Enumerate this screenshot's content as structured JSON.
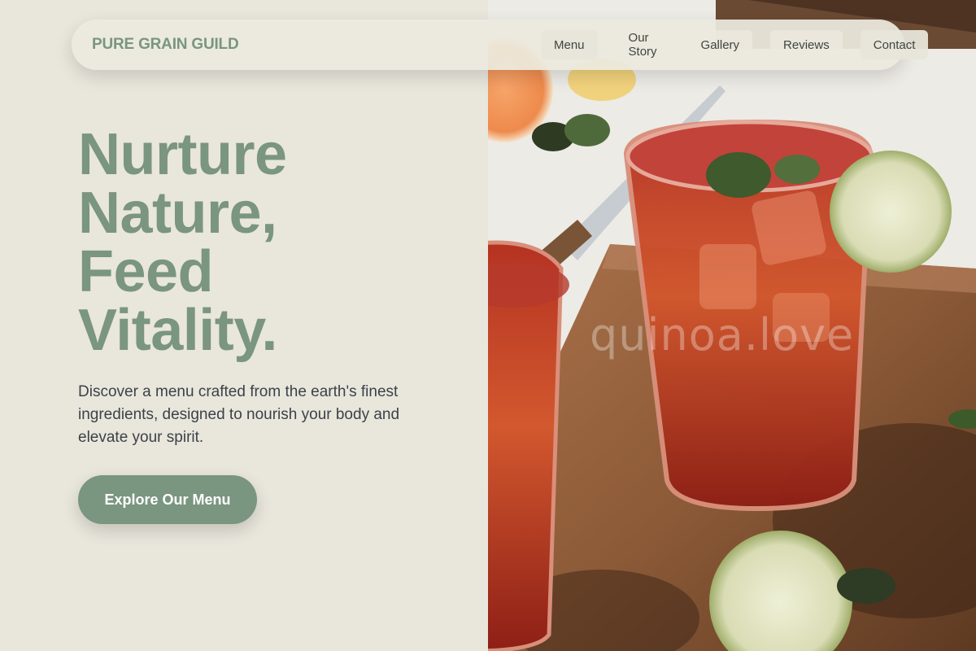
{
  "brand": {
    "name": "PURE GRAIN GUILD"
  },
  "nav": {
    "items": [
      {
        "label": "Menu"
      },
      {
        "label": "Our Story"
      },
      {
        "label": "Gallery"
      },
      {
        "label": "Reviews"
      },
      {
        "label": "Contact"
      }
    ]
  },
  "hero": {
    "title_lines": [
      "Nurture",
      "Nature,",
      "Feed",
      "Vitality."
    ],
    "subtitle": "Discover a menu crafted from the earth's finest ingredients, designed to nourish your body and elevate your spirit.",
    "cta_label": "Explore Our Menu"
  },
  "photo": {
    "watermark": "quinoa.love"
  },
  "colors": {
    "background": "#e9e6dc",
    "accent_sage": "#7a9580",
    "text_dark": "#3b4248"
  }
}
